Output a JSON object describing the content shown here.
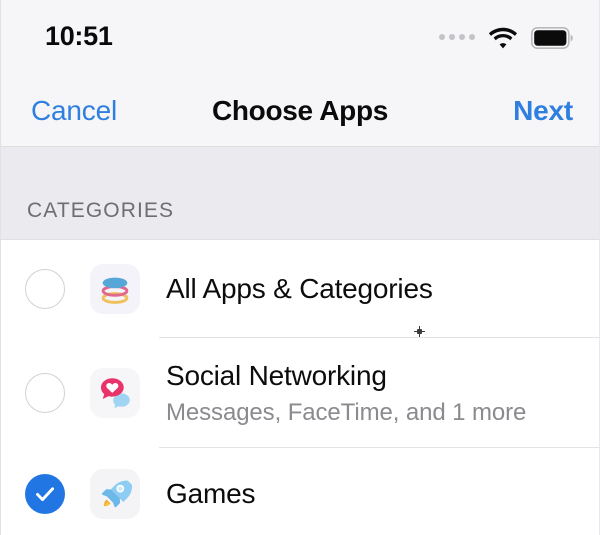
{
  "status_bar": {
    "time": "10:51",
    "cellular_icon": "signal-dots-icon",
    "wifi_icon": "wifi-icon",
    "battery_icon": "battery-full-icon"
  },
  "nav_bar": {
    "cancel_label": "Cancel",
    "title": "Choose Apps",
    "next_label": "Next",
    "tint_color": "#2e7fe0"
  },
  "section": {
    "header": "CATEGORIES"
  },
  "rows": [
    {
      "title": "All Apps & Categories",
      "subtitle": "",
      "selected": false,
      "icon": "layers-icon"
    },
    {
      "title": "Social Networking",
      "subtitle": "Messages, FaceTime, and 1 more",
      "selected": false,
      "icon": "speech-bubble-heart-icon"
    },
    {
      "title": "Games",
      "subtitle": "",
      "selected": true,
      "icon": "rocket-icon"
    }
  ],
  "colors": {
    "selected_checkbox": "#2176e3",
    "accent": "#2e7fe0",
    "section_background": "#ebebef",
    "bar_background": "#f6f6f8"
  }
}
